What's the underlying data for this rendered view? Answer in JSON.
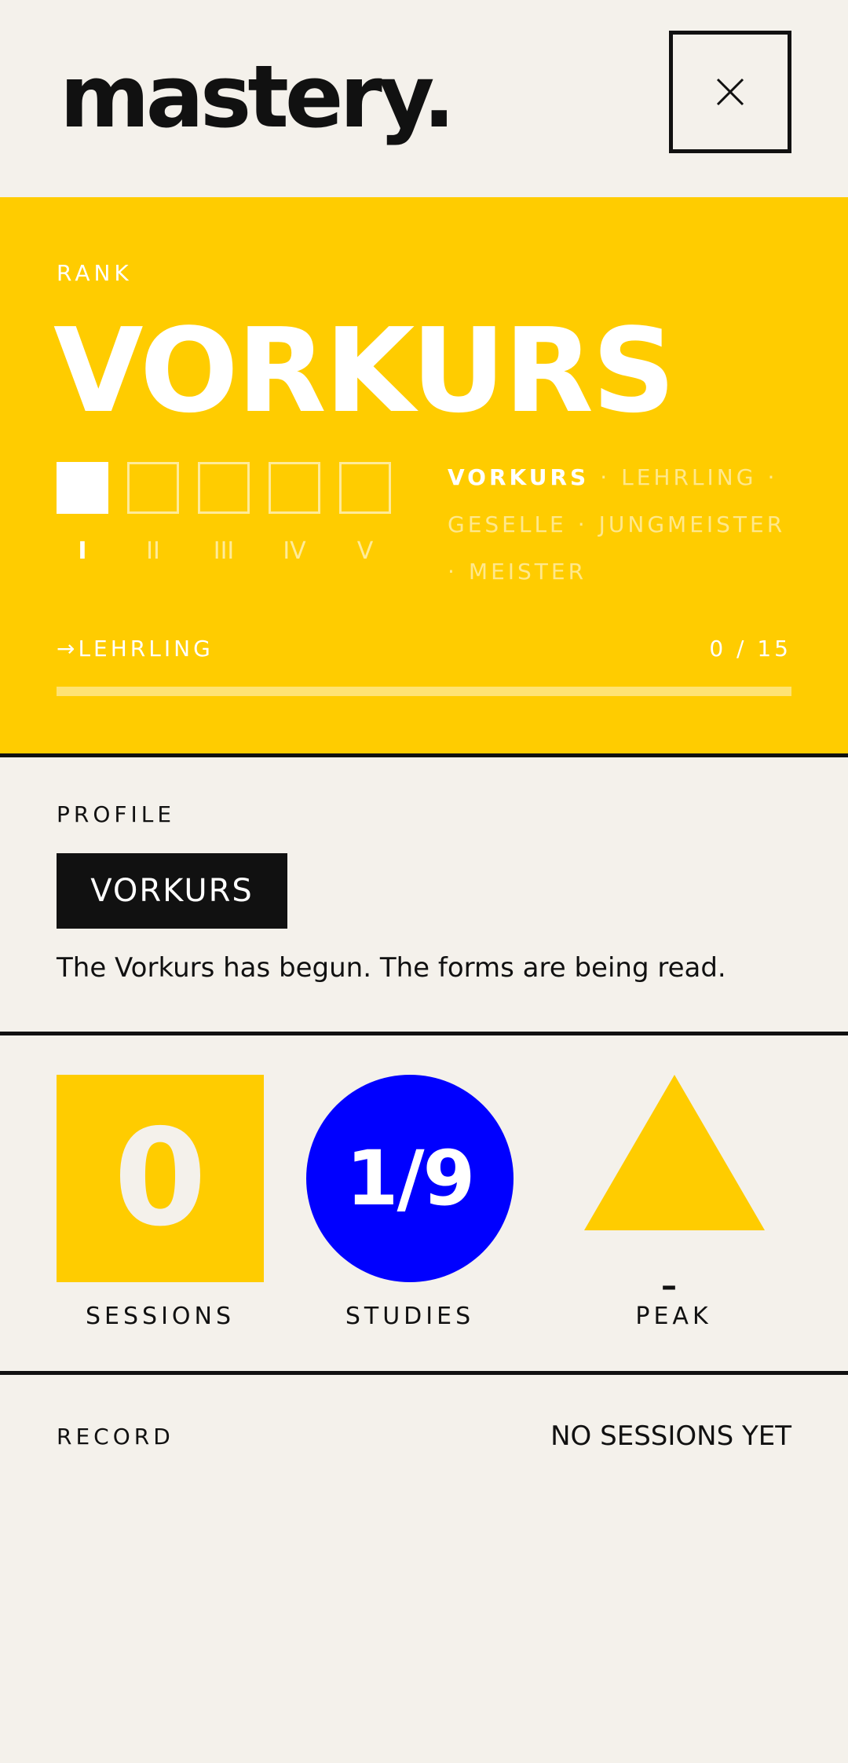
{
  "app": {
    "logo": "mastery."
  },
  "header": {
    "close_icon": "close-icon"
  },
  "rank": {
    "label": "RANK",
    "title": "VORKURS",
    "tiers": [
      "I",
      "II",
      "III",
      "IV",
      "V"
    ],
    "active_tier_index": 0,
    "path": [
      {
        "name": "VORKURS",
        "current": true
      },
      {
        "name": "LEHRLING",
        "current": false
      },
      {
        "name": "GESELLE",
        "current": false
      },
      {
        "name": "JUNGMEISTER",
        "current": false
      },
      {
        "name": "MEISTER",
        "current": false
      }
    ],
    "next_label": "→LEHRLING",
    "progress_text": "0 / 15",
    "progress_fraction": 0.0
  },
  "profile": {
    "label": "PROFILE",
    "badge": "VORKURS",
    "description": "The Vorkurs has begun. The forms are being read."
  },
  "stats": {
    "sessions": {
      "value": "0",
      "caption": "SESSIONS"
    },
    "studies": {
      "value": "1/9",
      "caption": "STUDIES"
    },
    "peak": {
      "value": "–",
      "caption": "PEAK"
    }
  },
  "record": {
    "label": "RECORD",
    "value": "NO SESSIONS YET"
  },
  "colors": {
    "accent_yellow": "#ffcc00",
    "accent_blue": "#0000ff",
    "ink": "#111111",
    "paper": "#f4f1eb"
  }
}
